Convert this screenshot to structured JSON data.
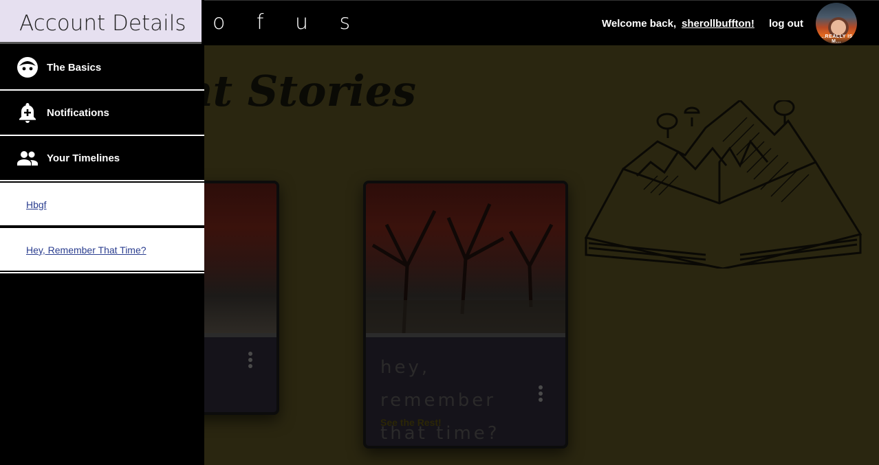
{
  "header": {
    "brand": "o f  u s",
    "welcome_text": "Welcome back,",
    "username": "sherollbuffton!",
    "logout_label": "log out",
    "avatar_caption": "...REALLY IS M..."
  },
  "main": {
    "section_title": "ent Stories",
    "cards": [
      {
        "title": "",
        "more_label": ""
      },
      {
        "title": "hey, remember that time?",
        "more_label": "See the Rest!"
      }
    ]
  },
  "sidebar": {
    "title": "Account Details",
    "items": [
      {
        "label": "The Basics",
        "icon": "face-icon"
      },
      {
        "label": "Notifications",
        "icon": "bell-plus-icon"
      },
      {
        "label": "Your Timelines",
        "icon": "people-icon"
      }
    ],
    "timelines": [
      {
        "label": "Hbgf"
      },
      {
        "label": "Hey, Remember That Time?"
      }
    ]
  },
  "colors": {
    "sidebar_header_bg": "#e6e0f0",
    "link": "#2a3d8f",
    "overlay_main": "#2a2610"
  }
}
